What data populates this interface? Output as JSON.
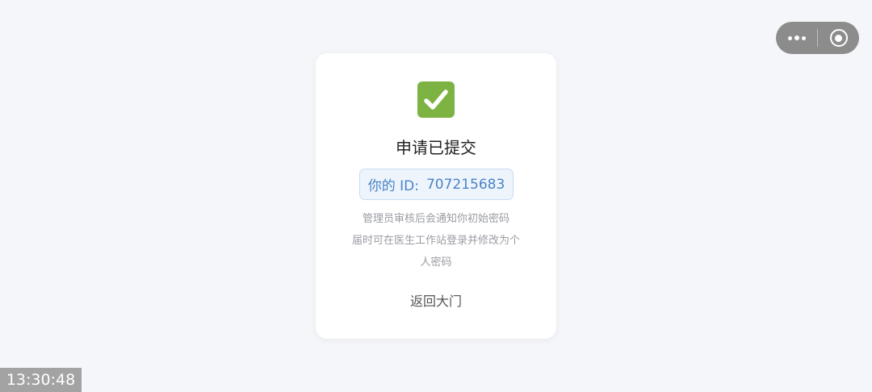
{
  "capsule": {
    "more_icon": "more-dots-icon",
    "close_icon": "target-close-icon"
  },
  "result": {
    "icon": "check-box-icon",
    "title": "申请已提交",
    "id_label": "你的 ID:",
    "id_value": "707215683",
    "desc_lines": [
      "管理员审核后会通知你初始密码",
      "届时可在医生工作站登录并修改为个",
      "人密码"
    ],
    "back_label": "返回大门"
  },
  "colors": {
    "accent_green": "#7cb342",
    "id_blue": "#4a83c6"
  },
  "clock": "13:30:48"
}
